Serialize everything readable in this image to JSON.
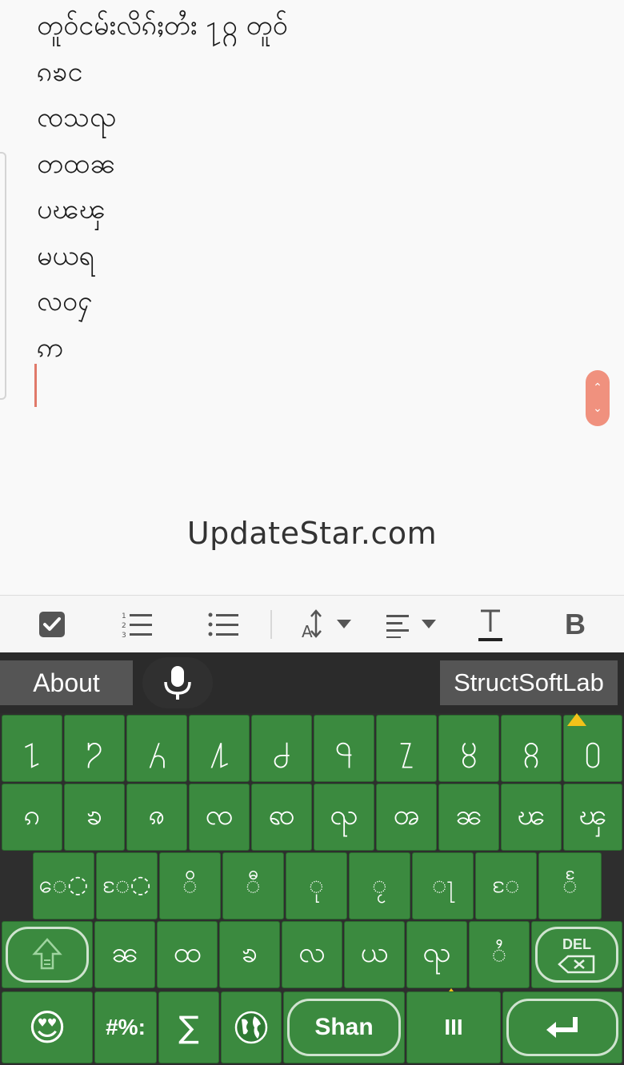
{
  "editor": {
    "lines": [
      "တူဝ်ငမ်းလိၵ်ႈတႆး ႑႙ တူဝ်",
      "ၵၶင",
      "ၸသၺ",
      "တထၼ",
      "ပၽၾ",
      "မယရ",
      "လဝႁ",
      "ဢ"
    ],
    "watermark": "UpdateStar.com",
    "scroll_up": "⌃",
    "scroll_down": "⌄"
  },
  "toolbar": {
    "buttons": [
      {
        "name": "checkbox-icon"
      },
      {
        "name": "numbered-list-icon"
      },
      {
        "name": "bullet-list-icon"
      },
      {
        "name": "text-size-icon"
      },
      {
        "name": "align-icon"
      },
      {
        "name": "text-style-icon"
      },
      {
        "name": "bold-icon",
        "label": "B"
      }
    ]
  },
  "keyboard": {
    "about_label": "About",
    "brand_label": "StructSoftLab",
    "accent": "#3b8a3f",
    "row1": [
      "႑",
      "႒",
      "႓",
      "႔",
      "႕",
      "႖",
      "႗",
      "႘",
      "႙",
      "႐"
    ],
    "row2": [
      "ၵ",
      "ၶ",
      "ၷ",
      "ၸ",
      "ၹ",
      "ၺ",
      "ၻ",
      "ၼ",
      "ၽ",
      "ၾ"
    ],
    "row3": [
      "ေ◌",
      "ႄ◌",
      "◌ိ",
      "◌ီ",
      "◌ု",
      "◌ႂ",
      "◌ႃ",
      "◌ႄ",
      "◌ႅ"
    ],
    "row4": [
      "ၼ",
      "ထ",
      "ၶ",
      "လ",
      "ယ",
      "ၺ",
      "◌ႆ"
    ],
    "row4_del": "DEL",
    "row5": {
      "emoji": "😍",
      "symbols": "#%:",
      "sigma": "∑",
      "globe": "🌐",
      "language": "Shan",
      "cursor_key": "III"
    }
  }
}
